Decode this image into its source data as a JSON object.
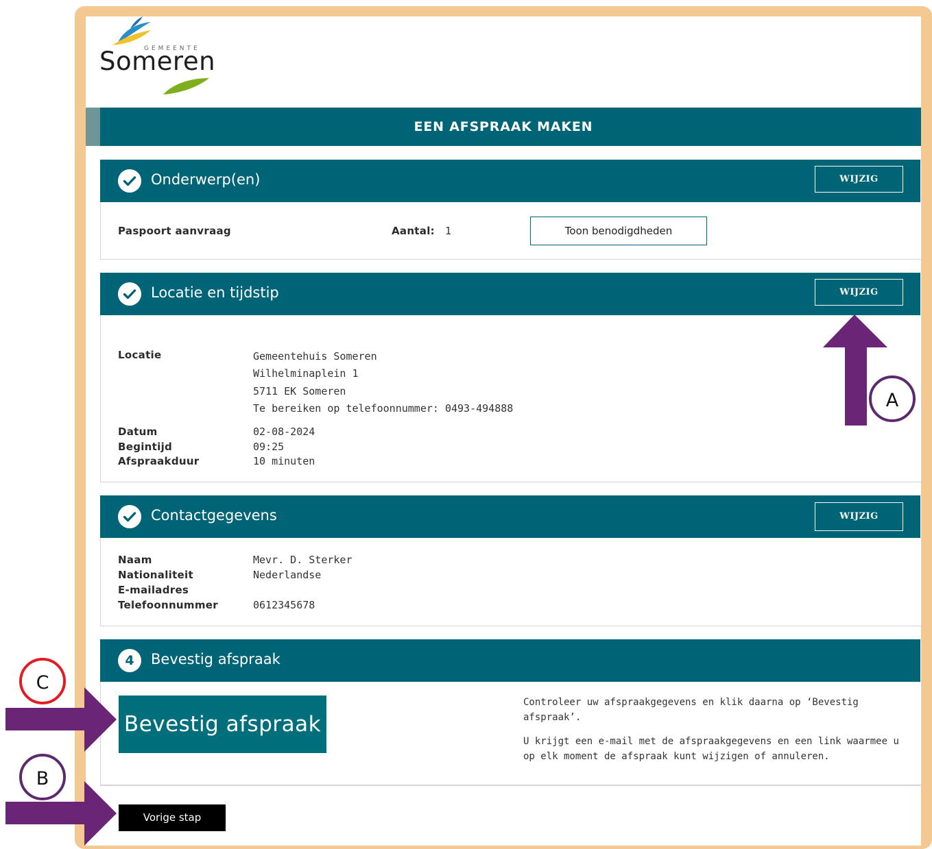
{
  "logo": {
    "sub": "GEMEENTE",
    "name": "Someren"
  },
  "page_title": "EEN AFSPRAAK MAKEN",
  "sections": {
    "subjects": {
      "title": "Onderwerp(en)",
      "edit_label": "WIJZIG",
      "item_name": "Paspoort aanvraag",
      "count_label": "Aantal:",
      "count_value": "1",
      "show_requirements_label": "Toon benodigdheden"
    },
    "location": {
      "title": "Locatie en tijdstip",
      "edit_label": "WIJZIG",
      "location_label": "Locatie",
      "location_lines": [
        "Gemeentehuis Someren",
        "Wilhelminaplein 1",
        "5711 EK Someren",
        "Te bereiken op telefoonnummer: 0493-494888"
      ],
      "date_label": "Datum",
      "date_value": "02-08-2024",
      "start_label": "Begintijd",
      "start_value": "09:25",
      "duration_label": "Afspraakduur",
      "duration_value": "10 minuten"
    },
    "contact": {
      "title": "Contactgegevens",
      "edit_label": "WIJZIG",
      "name_label": "Naam",
      "name_value": "Mevr. D. Sterker",
      "nationality_label": "Nationaliteit",
      "nationality_value": "Nederlandse",
      "email_label": "E-mailadres",
      "email_value": "",
      "phone_label": "Telefoonnummer",
      "phone_value": "0612345678"
    },
    "confirm": {
      "step_number": "4",
      "title": "Bevestig afspraak",
      "button_label": "Bevestig afspraak",
      "note_1": "Controleer uw afspraakgegevens en klik daarna op ‘Bevestig afspraak’.",
      "note_2": "U krijgt een e-mail met de afspraakgegevens en een link waarmee u op elk moment de afspraak kunt wijzigen of annuleren."
    }
  },
  "back_button_label": "Vorige stap",
  "annotations": {
    "a": {
      "label": "A",
      "color": "#5b2a6e"
    },
    "b": {
      "label": "B",
      "color": "#5b2a6e"
    },
    "c": {
      "label": "C",
      "color": "#e31b23"
    },
    "arrow_color": "#6b2577"
  },
  "colors": {
    "teal": "#006477",
    "frame": "#f4c891"
  }
}
